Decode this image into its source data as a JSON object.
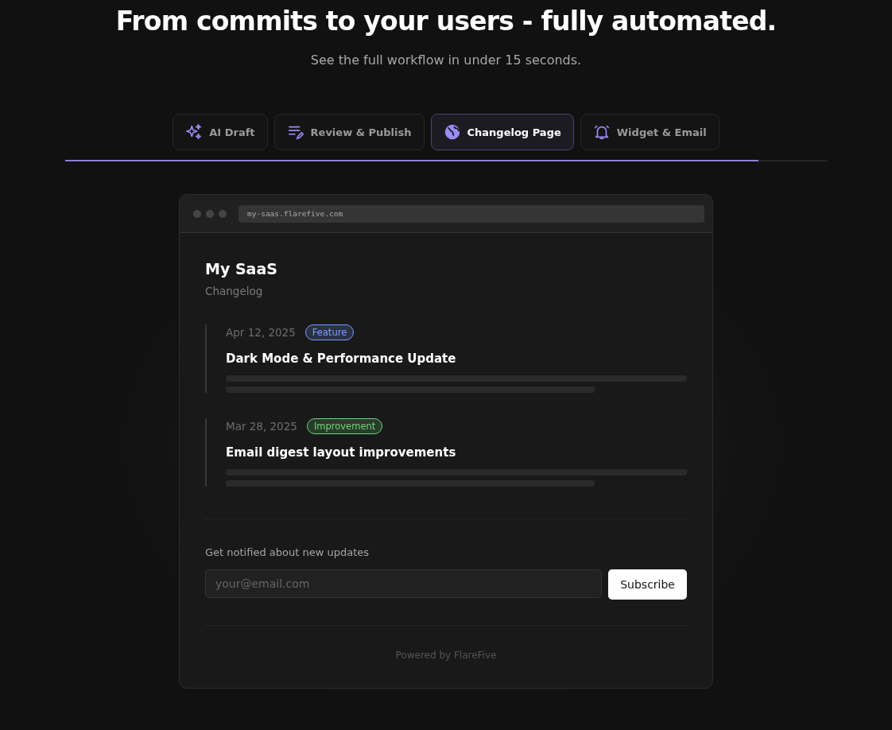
{
  "hero": {
    "title": "From commits to your users - fully automated.",
    "subtitle": "See the full workflow in under 15 seconds."
  },
  "tabs": [
    {
      "label": "AI Draft",
      "kind": "sparkle",
      "selected": false
    },
    {
      "label": "Review & Publish",
      "kind": "edit",
      "selected": false
    },
    {
      "label": "Changelog Page",
      "kind": "globe",
      "selected": true
    },
    {
      "label": "Widget & Email",
      "kind": "bell",
      "selected": false
    }
  ],
  "progress": {
    "level": 0.91
  },
  "browser": {
    "url": "my-saas.flarefive.com"
  },
  "page": {
    "title": "My SaaS",
    "subtitle": "Changelog",
    "entries": [
      {
        "date": "Apr 12, 2025",
        "tag": "Feature",
        "color": "#7b9cff",
        "title": "Dark Mode & Performance Update"
      },
      {
        "date": "Mar 28, 2025",
        "tag": "Improvement",
        "color": "#6fd47a",
        "title": "Email digest layout improvements"
      }
    ],
    "notify_label": "Get notified about new updates",
    "email_placeholder": "your@email.com",
    "subscribe": "Subscribe",
    "footer": "Powered by FlareFive"
  }
}
